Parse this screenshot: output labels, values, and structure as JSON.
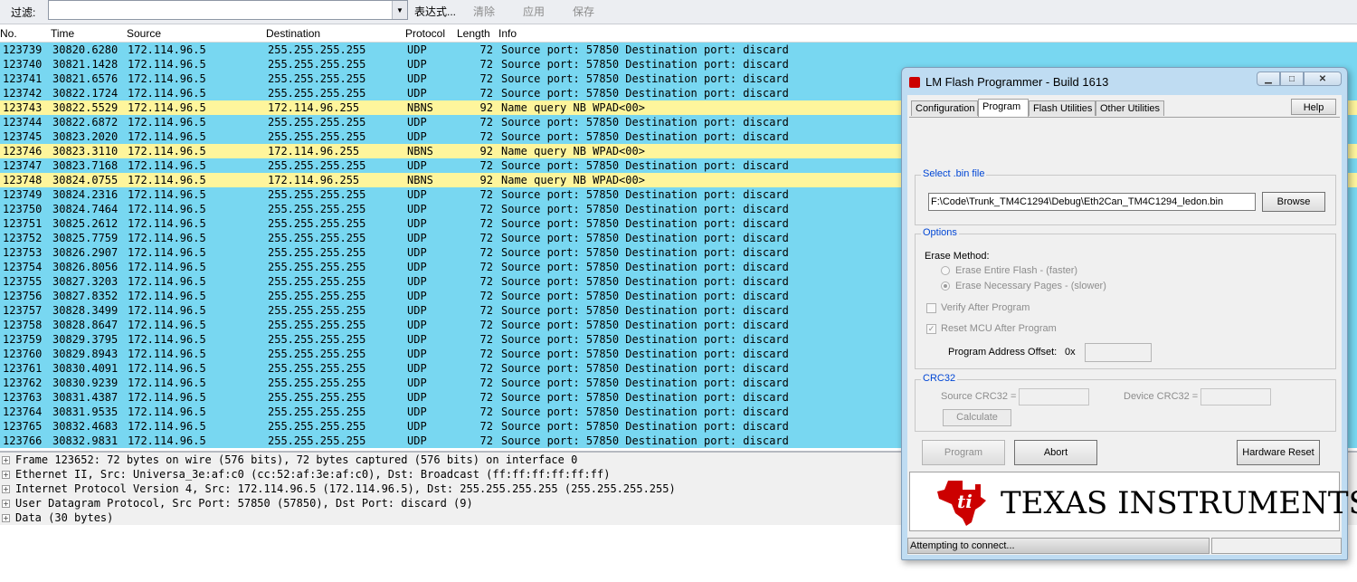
{
  "filter": {
    "label": "过滤:",
    "value": "",
    "expression": "表达式...",
    "clear": "清除",
    "apply": "应用",
    "save": "保存"
  },
  "columns": {
    "no": "No.",
    "time": "Time",
    "source": "Source",
    "destination": "Destination",
    "protocol": "Protocol",
    "length": "Length",
    "info": "Info"
  },
  "packets": [
    {
      "no": "123739",
      "time": "30820.6280",
      "src": "172.114.96.5",
      "dst": "255.255.255.255",
      "proto": "UDP",
      "len": "72",
      "info": "Source port: 57850  Destination port: discard"
    },
    {
      "no": "123740",
      "time": "30821.1428",
      "src": "172.114.96.5",
      "dst": "255.255.255.255",
      "proto": "UDP",
      "len": "72",
      "info": "Source port: 57850  Destination port: discard"
    },
    {
      "no": "123741",
      "time": "30821.6576",
      "src": "172.114.96.5",
      "dst": "255.255.255.255",
      "proto": "UDP",
      "len": "72",
      "info": "Source port: 57850  Destination port: discard"
    },
    {
      "no": "123742",
      "time": "30822.1724",
      "src": "172.114.96.5",
      "dst": "255.255.255.255",
      "proto": "UDP",
      "len": "72",
      "info": "Source port: 57850  Destination port: discard"
    },
    {
      "no": "123743",
      "time": "30822.5529",
      "src": "172.114.96.5",
      "dst": "172.114.96.255",
      "proto": "NBNS",
      "len": "92",
      "info": "Name query NB WPAD<00>"
    },
    {
      "no": "123744",
      "time": "30822.6872",
      "src": "172.114.96.5",
      "dst": "255.255.255.255",
      "proto": "UDP",
      "len": "72",
      "info": "Source port: 57850  Destination port: discard"
    },
    {
      "no": "123745",
      "time": "30823.2020",
      "src": "172.114.96.5",
      "dst": "255.255.255.255",
      "proto": "UDP",
      "len": "72",
      "info": "Source port: 57850  Destination port: discard"
    },
    {
      "no": "123746",
      "time": "30823.3110",
      "src": "172.114.96.5",
      "dst": "172.114.96.255",
      "proto": "NBNS",
      "len": "92",
      "info": "Name query NB WPAD<00>"
    },
    {
      "no": "123747",
      "time": "30823.7168",
      "src": "172.114.96.5",
      "dst": "255.255.255.255",
      "proto": "UDP",
      "len": "72",
      "info": "Source port: 57850  Destination port: discard"
    },
    {
      "no": "123748",
      "time": "30824.0755",
      "src": "172.114.96.5",
      "dst": "172.114.96.255",
      "proto": "NBNS",
      "len": "92",
      "info": "Name query NB WPAD<00>"
    },
    {
      "no": "123749",
      "time": "30824.2316",
      "src": "172.114.96.5",
      "dst": "255.255.255.255",
      "proto": "UDP",
      "len": "72",
      "info": "Source port: 57850  Destination port: discard"
    },
    {
      "no": "123750",
      "time": "30824.7464",
      "src": "172.114.96.5",
      "dst": "255.255.255.255",
      "proto": "UDP",
      "len": "72",
      "info": "Source port: 57850  Destination port: discard"
    },
    {
      "no": "123751",
      "time": "30825.2612",
      "src": "172.114.96.5",
      "dst": "255.255.255.255",
      "proto": "UDP",
      "len": "72",
      "info": "Source port: 57850  Destination port: discard"
    },
    {
      "no": "123752",
      "time": "30825.7759",
      "src": "172.114.96.5",
      "dst": "255.255.255.255",
      "proto": "UDP",
      "len": "72",
      "info": "Source port: 57850  Destination port: discard"
    },
    {
      "no": "123753",
      "time": "30826.2907",
      "src": "172.114.96.5",
      "dst": "255.255.255.255",
      "proto": "UDP",
      "len": "72",
      "info": "Source port: 57850  Destination port: discard"
    },
    {
      "no": "123754",
      "time": "30826.8056",
      "src": "172.114.96.5",
      "dst": "255.255.255.255",
      "proto": "UDP",
      "len": "72",
      "info": "Source port: 57850  Destination port: discard"
    },
    {
      "no": "123755",
      "time": "30827.3203",
      "src": "172.114.96.5",
      "dst": "255.255.255.255",
      "proto": "UDP",
      "len": "72",
      "info": "Source port: 57850  Destination port: discard"
    },
    {
      "no": "123756",
      "time": "30827.8352",
      "src": "172.114.96.5",
      "dst": "255.255.255.255",
      "proto": "UDP",
      "len": "72",
      "info": "Source port: 57850  Destination port: discard"
    },
    {
      "no": "123757",
      "time": "30828.3499",
      "src": "172.114.96.5",
      "dst": "255.255.255.255",
      "proto": "UDP",
      "len": "72",
      "info": "Source port: 57850  Destination port: discard"
    },
    {
      "no": "123758",
      "time": "30828.8647",
      "src": "172.114.96.5",
      "dst": "255.255.255.255",
      "proto": "UDP",
      "len": "72",
      "info": "Source port: 57850  Destination port: discard"
    },
    {
      "no": "123759",
      "time": "30829.3795",
      "src": "172.114.96.5",
      "dst": "255.255.255.255",
      "proto": "UDP",
      "len": "72",
      "info": "Source port: 57850  Destination port: discard"
    },
    {
      "no": "123760",
      "time": "30829.8943",
      "src": "172.114.96.5",
      "dst": "255.255.255.255",
      "proto": "UDP",
      "len": "72",
      "info": "Source port: 57850  Destination port: discard"
    },
    {
      "no": "123761",
      "time": "30830.4091",
      "src": "172.114.96.5",
      "dst": "255.255.255.255",
      "proto": "UDP",
      "len": "72",
      "info": "Source port: 57850  Destination port: discard"
    },
    {
      "no": "123762",
      "time": "30830.9239",
      "src": "172.114.96.5",
      "dst": "255.255.255.255",
      "proto": "UDP",
      "len": "72",
      "info": "Source port: 57850  Destination port: discard"
    },
    {
      "no": "123763",
      "time": "30831.4387",
      "src": "172.114.96.5",
      "dst": "255.255.255.255",
      "proto": "UDP",
      "len": "72",
      "info": "Source port: 57850  Destination port: discard"
    },
    {
      "no": "123764",
      "time": "30831.9535",
      "src": "172.114.96.5",
      "dst": "255.255.255.255",
      "proto": "UDP",
      "len": "72",
      "info": "Source port: 57850  Destination port: discard"
    },
    {
      "no": "123765",
      "time": "30832.4683",
      "src": "172.114.96.5",
      "dst": "255.255.255.255",
      "proto": "UDP",
      "len": "72",
      "info": "Source port: 57850  Destination port: discard"
    },
    {
      "no": "123766",
      "time": "30832.9831",
      "src": "172.114.96.5",
      "dst": "255.255.255.255",
      "proto": "UDP",
      "len": "72",
      "info": "Source port: 57850  Destination port: discard"
    }
  ],
  "details": [
    "Frame 123652: 72 bytes on wire (576 bits), 72 bytes captured (576 bits) on interface 0",
    "Ethernet II, Src: Universa_3e:af:c0 (cc:52:af:3e:af:c0), Dst: Broadcast (ff:ff:ff:ff:ff:ff)",
    "Internet Protocol Version 4, Src: 172.114.96.5 (172.114.96.5), Dst: 255.255.255.255 (255.255.255.255)",
    "User Datagram Protocol, Src Port: 57850 (57850), Dst Port: discard (9)",
    "Data (30 bytes)"
  ],
  "colors": {
    "udp_row": "#78d7f1",
    "nbns_row": "#fef59c",
    "group_title": "#0046d5"
  },
  "dialog": {
    "title": "LM Flash Programmer - Build 1613",
    "tabs": [
      "Configuration",
      "Program",
      "Flash Utilities",
      "Other Utilities"
    ],
    "active_tab": "Program",
    "help": "Help",
    "select_bin": {
      "title": "Select .bin file",
      "path": "F:\\Code\\Trunk_TM4C1294\\Debug\\Eth2Can_TM4C1294_ledon.bin",
      "browse": "Browse"
    },
    "options": {
      "title": "Options",
      "erase_method": "Erase Method:",
      "erase_entire": "Erase Entire Flash - (faster)",
      "erase_necessary": "Erase Necessary Pages - (slower)",
      "verify": "Verify After Program",
      "reset": "Reset MCU After Program",
      "offset_label": "Program Address Offset:",
      "offset_prefix": "0x",
      "offset_value": ""
    },
    "crc": {
      "title": "CRC32",
      "source": "Source CRC32 =",
      "device": "Device CRC32 =",
      "calculate": "Calculate"
    },
    "program": "Program",
    "abort": "Abort",
    "hardware_reset": "Hardware Reset",
    "logo_text": "TEXAS INSTRUMENTS",
    "status": "Attempting to connect..."
  }
}
